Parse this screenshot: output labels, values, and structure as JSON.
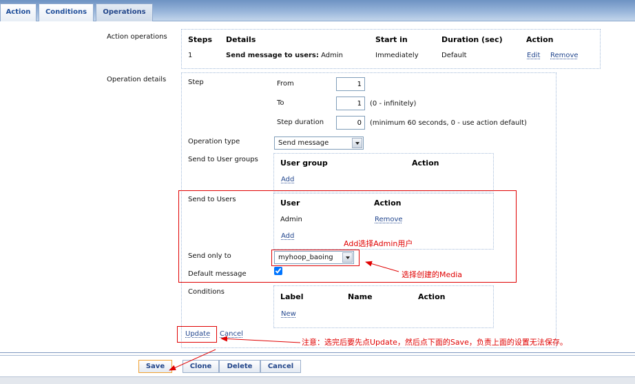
{
  "tabs": [
    {
      "label": "Action",
      "active": false
    },
    {
      "label": "Conditions",
      "active": false
    },
    {
      "label": "Operations",
      "active": true
    }
  ],
  "action_operations": {
    "label": "Action operations",
    "headers": [
      "Steps",
      "Details",
      "Start in",
      "Duration (sec)",
      "Action"
    ],
    "rows": [
      {
        "steps": "1",
        "details_prefix": "Send message to users:",
        "details_value": "Admin",
        "start_in": "Immediately",
        "duration": "Default",
        "edit": "Edit",
        "remove": "Remove"
      }
    ]
  },
  "operation_details": {
    "label": "Operation details",
    "step": {
      "label": "Step",
      "from_label": "From",
      "from_value": "1",
      "to_label": "To",
      "to_value": "1",
      "to_hint": "(0 - infinitely)",
      "duration_label": "Step duration",
      "duration_value": "0",
      "duration_hint": "(minimum 60 seconds, 0 - use action default)"
    },
    "operation_type": {
      "label": "Operation type",
      "value": "Send message"
    },
    "user_groups": {
      "label": "Send to User groups",
      "headers": [
        "User group",
        "Action"
      ],
      "add": "Add"
    },
    "users": {
      "label": "Send to Users",
      "headers": [
        "User",
        "Action"
      ],
      "rows": [
        {
          "user": "Admin",
          "action": "Remove"
        }
      ],
      "add": "Add"
    },
    "send_only_to": {
      "label": "Send only to",
      "value": "myhoop_baoing"
    },
    "default_message": {
      "label": "Default message",
      "checked": true
    },
    "conditions": {
      "label": "Conditions",
      "headers": [
        "Label",
        "Name",
        "Action"
      ],
      "new": "New"
    },
    "update": "Update",
    "cancel": "Cancel"
  },
  "footer_buttons": {
    "save": "Save",
    "clone": "Clone",
    "delete": "Delete",
    "cancel": "Cancel"
  },
  "annotations": {
    "add_admin": "Add选择Admin用户",
    "select_media": "选择创建的Media",
    "note": "注意：选完后要先点Update，然后点下面的Save，负责上面的设置无法保存。"
  },
  "colors": {
    "link": "#24488f",
    "annotation": "#e00000",
    "tab_text": "#1f4e9a",
    "save_highlight": "#f0a030"
  }
}
